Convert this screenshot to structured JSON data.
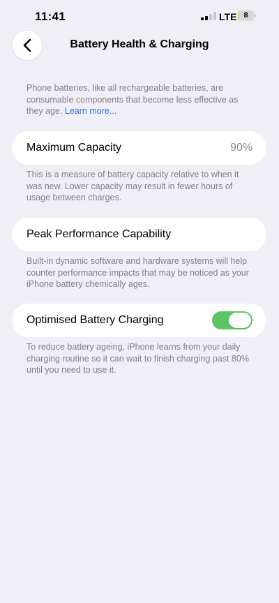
{
  "status_bar": {
    "time": "11:41",
    "network": "LTE",
    "battery_level": "8",
    "battery_fraction": 0.08
  },
  "nav": {
    "title": "Battery Health & Charging",
    "back_icon": "chevron-left-icon"
  },
  "intro": {
    "text": "Phone batteries, like all rechargeable batteries, are consumable components that become less effective as they age. ",
    "link": "Learn more..."
  },
  "maximum_capacity": {
    "label": "Maximum Capacity",
    "value": "90%",
    "footnote": "This is a measure of battery capacity relative to when it was new. Lower capacity may result in fewer hours of usage between charges."
  },
  "peak_performance": {
    "label": "Peak Performance Capability",
    "footnote": "Built-in dynamic software and hardware systems will help counter performance impacts that may be noticed as your iPhone battery chemically ages."
  },
  "optimised_charging": {
    "label": "Optimised Battery Charging",
    "enabled": true,
    "footnote": "To reduce battery ageing, iPhone learns from your daily charging routine so it can wait to finish charging past 80% until you need to use it."
  },
  "colors": {
    "background": "#f0eff6",
    "accent_link": "#2f6fd6",
    "toggle_on": "#5cc666",
    "battery_low": "#f3c55b"
  }
}
